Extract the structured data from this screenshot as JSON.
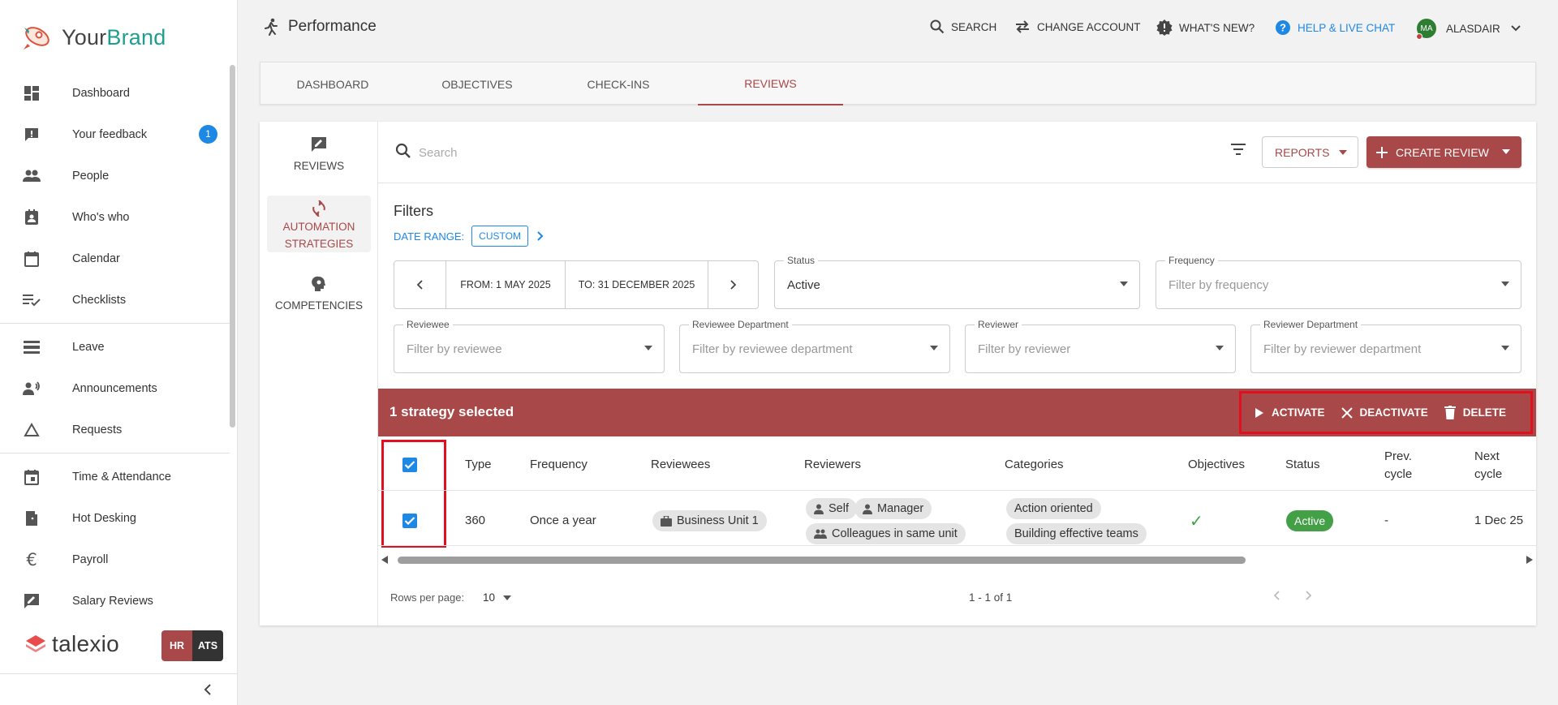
{
  "brand": {
    "name_part1": "Your",
    "name_part2": "Brand"
  },
  "sidebar": {
    "items": [
      {
        "label": "Dashboard",
        "icon": "dashboard-icon"
      },
      {
        "label": "Your feedback",
        "icon": "feedback-icon",
        "badge": "1"
      },
      {
        "label": "People",
        "icon": "people-icon"
      },
      {
        "label": "Who's who",
        "icon": "contact-card-icon"
      },
      {
        "label": "Calendar",
        "icon": "calendar-icon"
      },
      {
        "label": "Checklists",
        "icon": "checklist-icon"
      },
      {
        "label": "Leave",
        "icon": "leave-icon"
      },
      {
        "label": "Announcements",
        "icon": "announcement-icon"
      },
      {
        "label": "Requests",
        "icon": "triangle-icon"
      },
      {
        "label": "Time & Attendance",
        "icon": "calendar-clock-icon"
      },
      {
        "label": "Hot Desking",
        "icon": "door-icon"
      },
      {
        "label": "Payroll",
        "icon": "euro-icon"
      },
      {
        "label": "Salary Reviews",
        "icon": "rate-review-icon"
      }
    ],
    "footer_brand": "talexio",
    "system_switch": {
      "hr": "HR",
      "ats": "ATS"
    }
  },
  "header": {
    "title": "Performance",
    "actions": {
      "search": "SEARCH",
      "change_account": "CHANGE ACCOUNT",
      "whats_new": "WHAT'S NEW?",
      "help": "HELP & LIVE CHAT",
      "user_initials": "MA",
      "user_name": "ALASDAIR"
    }
  },
  "tabs": [
    {
      "label": "DASHBOARD"
    },
    {
      "label": "OBJECTIVES"
    },
    {
      "label": "CHECK-INS"
    },
    {
      "label": "REVIEWS",
      "active": true
    }
  ],
  "subnav": [
    {
      "label": "REVIEWS"
    },
    {
      "label": "AUTOMATION STRATEGIES",
      "active": true
    },
    {
      "label": "COMPETENCIES"
    }
  ],
  "toolbar": {
    "search_placeholder": "Search",
    "reports_label": "REPORTS",
    "create_label": "CREATE REVIEW"
  },
  "filters": {
    "title": "Filters",
    "date_range_label": "DATE RANGE:",
    "date_range_mode": "CUSTOM",
    "from": "FROM: 1 MAY 2025",
    "to": "TO: 31 DECEMBER 2025",
    "status": {
      "label": "Status",
      "value": "Active"
    },
    "frequency": {
      "label": "Frequency",
      "placeholder": "Filter by frequency"
    },
    "reviewee": {
      "label": "Reviewee",
      "placeholder": "Filter by reviewee"
    },
    "reviewee_department": {
      "label": "Reviewee Department",
      "placeholder": "Filter by reviewee department"
    },
    "reviewer": {
      "label": "Reviewer",
      "placeholder": "Filter by reviewer"
    },
    "reviewer_department": {
      "label": "Reviewer Department",
      "placeholder": "Filter by reviewer department"
    }
  },
  "selection": {
    "count_text": "1 strategy selected",
    "activate": "ACTIVATE",
    "deactivate": "DEACTIVATE",
    "delete": "DELETE"
  },
  "table": {
    "columns": {
      "type": "Type",
      "frequency": "Frequency",
      "reviewees": "Reviewees",
      "reviewers": "Reviewers",
      "categories": "Categories",
      "objectives": "Objectives",
      "status": "Status",
      "prev_cycle_1": "Prev.",
      "prev_cycle_2": "cycle",
      "next_cycle_1": "Next",
      "next_cycle_2": "cycle"
    },
    "rows": [
      {
        "type": "360",
        "frequency": "Once a year",
        "reviewee": "Business Unit 1",
        "reviewers": [
          "Self",
          "Manager",
          "Colleagues in same unit"
        ],
        "categories": [
          "Action oriented",
          "Building effective teams"
        ],
        "objectives": "✓",
        "status": "Active",
        "prev_cycle": "-",
        "next_cycle": "1 Dec 25"
      }
    ]
  },
  "pagination": {
    "rows_per_page_label": "Rows per page:",
    "rows_per_page": "10",
    "range": "1 - 1 of 1"
  },
  "colors": {
    "accent": "#a84848",
    "link_blue": "#1e88e5",
    "success": "#43a047",
    "highlight": "#e0101e"
  }
}
